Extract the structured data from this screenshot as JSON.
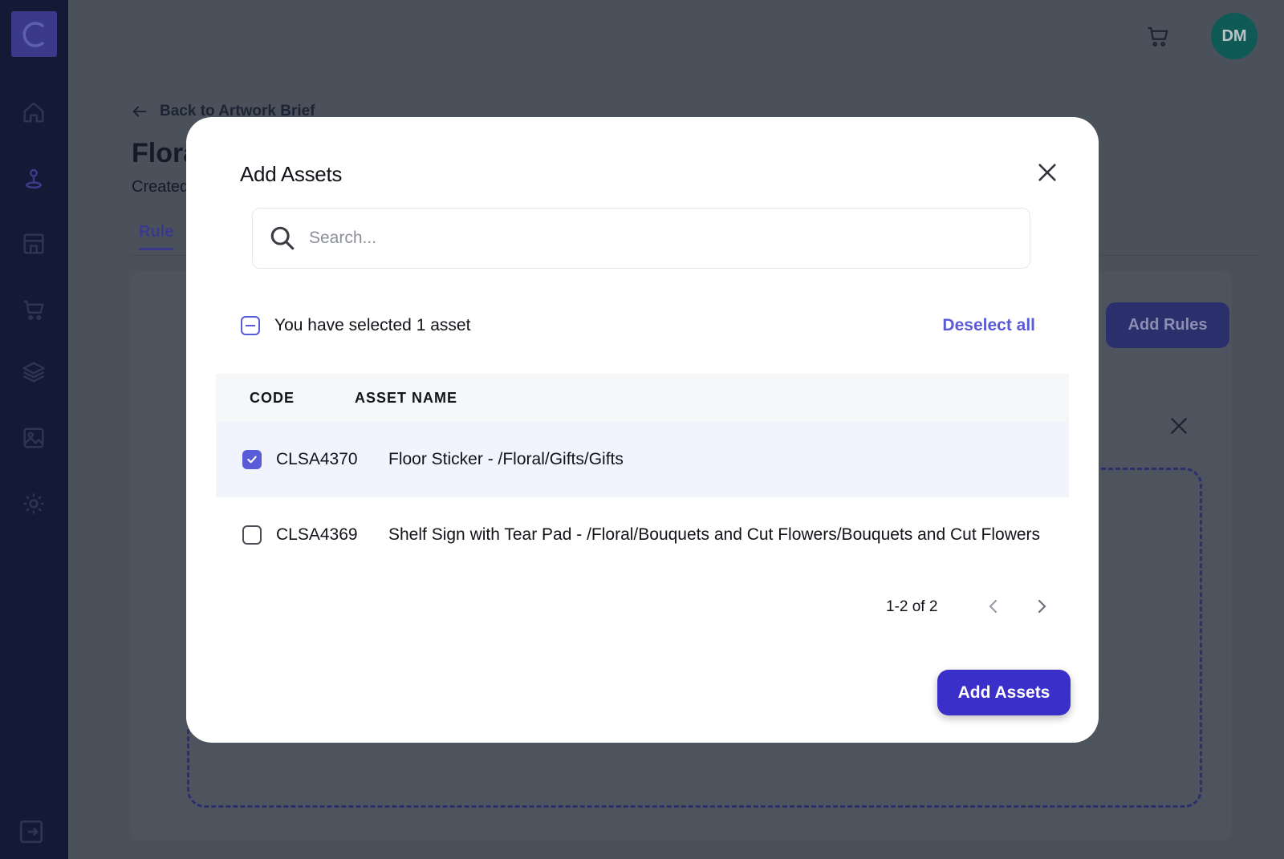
{
  "header": {
    "avatar_initials": "DM"
  },
  "background": {
    "back_link": "Back to Artwork Brief",
    "title": "Flora",
    "subtitle": "Created",
    "tab_rule": "Rule",
    "add_rules_label": "Add Rules"
  },
  "modal": {
    "title": "Add Assets",
    "search_placeholder": "Search...",
    "selection_text": "You have selected 1 asset",
    "deselect_all": "Deselect all",
    "columns": {
      "code": "CODE",
      "asset_name": "ASSET NAME"
    },
    "rows": [
      {
        "code": "CLSA4370",
        "name": "Floor Sticker - /Floral/Gifts/Gifts",
        "checked": true
      },
      {
        "code": "CLSA4369",
        "name": "Shelf Sign with Tear Pad - /Floral/Bouquets and Cut Flowers/Bouquets and Cut Flowers",
        "checked": false
      }
    ],
    "pagination": "1-2 of 2",
    "submit_label": "Add Assets"
  },
  "colors": {
    "accent": "#5a5bd6",
    "primary_button": "#3b2fc9",
    "sidebar": "#121a35"
  }
}
